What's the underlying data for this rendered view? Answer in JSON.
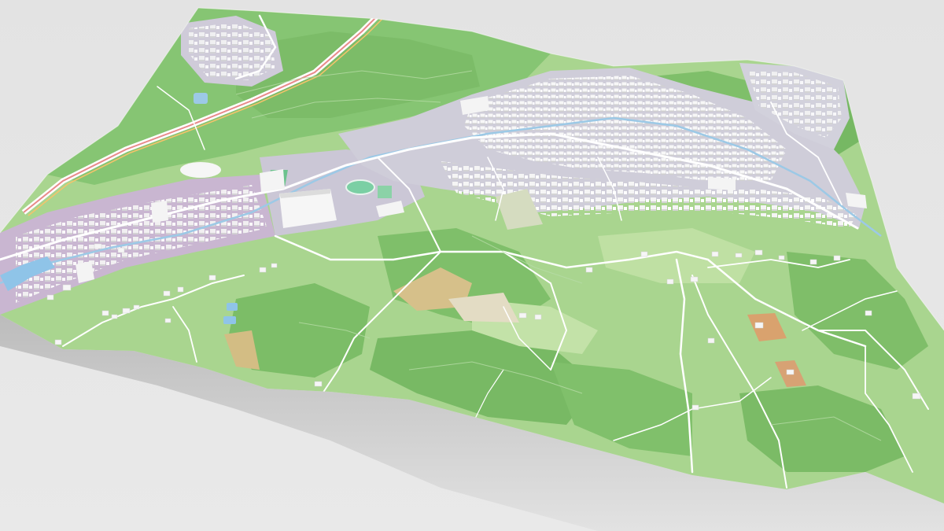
{
  "scene": {
    "kind": "3d-terrain-map",
    "background_color": "#e6e6e6",
    "shadow_color": "#bdbdbd",
    "terrain_side_color": "#d8d8d8"
  },
  "colors": {
    "meadow": "#a9d58f",
    "meadow_light": "#c3e2a8",
    "forest": "#7fbf6a",
    "forest_dark": "#69ad57",
    "urban": "#c9c5d6",
    "industrial": "#c7b3cf",
    "residential": "#cfcfd8",
    "building": "#f4f4f4",
    "building_shade": "#d9d9d9",
    "road_minor": "#ffffff",
    "highway": "#e88a8a",
    "highway_fill": "#f5c36b",
    "water": "#8fc4e8",
    "sports_field": "#7ccfa0",
    "farmland_tan": "#d6c08a",
    "farmland_orange": "#d9a26e"
  },
  "legend_icons": [
    "building-icon",
    "road-icon",
    "highway-icon",
    "water-icon",
    "forest-icon"
  ]
}
